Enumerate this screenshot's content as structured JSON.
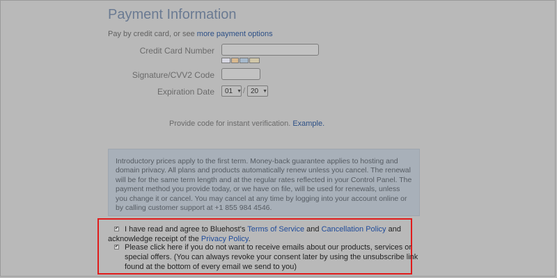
{
  "header": {
    "title": "Payment Information",
    "subtitle_prefix": "Pay by credit card, or see ",
    "subtitle_link": "more payment options"
  },
  "form": {
    "card_number_label": "Credit Card Number",
    "card_number_value": "",
    "cvv_label": "Signature/CVV2 Code",
    "cvv_value": "",
    "expiration_label": "Expiration Date",
    "exp_month": "01",
    "exp_separator": "/",
    "exp_year": "20",
    "card_brands": [
      "VISA",
      "MasterCard",
      "AmEx",
      "Discover"
    ]
  },
  "verification": {
    "text": "Provide code for instant verification. ",
    "link": "Example."
  },
  "notice": {
    "text": "Introductory prices apply to the first term. Money-back guarantee applies to hosting and domain privacy. All plans and products automatically renew unless you cancel. The renewal will be for the same term length and at the regular rates reflected in your Control Panel. The payment method you provide today, or we have on file, will be used for renewals, unless you change it or cancel. You may cancel at any time by logging into your account online or by calling customer support at +1 855 984 4546."
  },
  "consent": {
    "terms_checked": true,
    "terms_prefix": "I have read and agree to Bluehost's ",
    "terms_link": "Terms of Service",
    "terms_and": " and ",
    "cancellation_link": "Cancellation Policy",
    "terms_suffix": " and",
    "terms_line2_prefix": "acknowledge receipt of the ",
    "privacy_link": "Privacy Policy",
    "terms_line2_suffix": ".",
    "emails_checked": true,
    "emails_line1": "Please click here if you do not want to receive emails about our products, services or",
    "emails_line2": "special offers. (You can always revoke your consent later by using the unsubscribe link",
    "emails_line3": "found at the bottom of every email we send to you)"
  },
  "colors": {
    "highlight_border": "#e01b1b",
    "link": "#1f4b9a",
    "title": "#6a7a92"
  }
}
